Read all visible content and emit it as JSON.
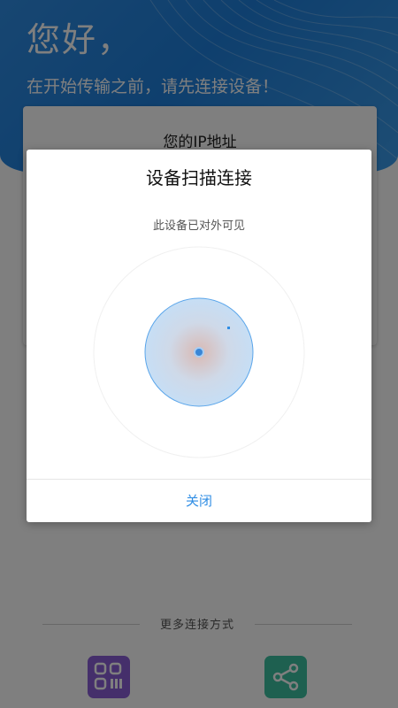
{
  "header": {
    "greeting": "您好，",
    "prompt": "在开始传输之前，请先连接设备！"
  },
  "ip_card": {
    "title": "您的IP地址"
  },
  "more": {
    "label": "更多连接方式",
    "buttons": [
      {
        "icon": "qr-code-icon",
        "color": "#8a5ed6"
      },
      {
        "icon": "share-icon",
        "color": "#3cc0a0"
      }
    ]
  },
  "dialog": {
    "title": "设备扫描连接",
    "subtitle": "此设备已对外可见",
    "close_label": "关闭"
  },
  "colors": {
    "accent": "#2f8de4",
    "header": "#1e7fdc"
  }
}
